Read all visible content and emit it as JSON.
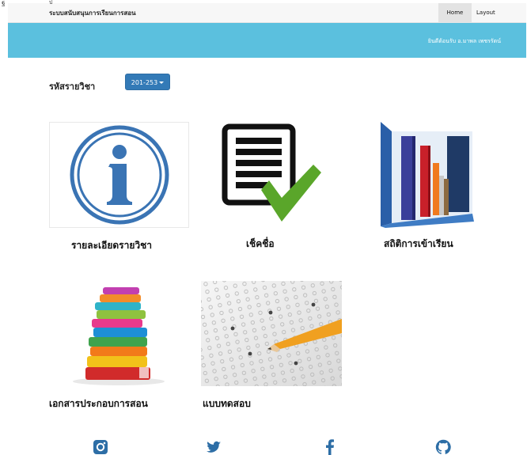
{
  "header": {
    "corner_glyph": "ฐ",
    "corner_mark": "ป",
    "brand": "ระบบสนับสนุนการเรียนการสอน",
    "nav": {
      "home": "Home",
      "layout": "Layout"
    }
  },
  "banner": {
    "welcome": "ยินดีต้อนรับ อ.มาพล เพชรรัตน์"
  },
  "course": {
    "label": "รหัสรายวิชา",
    "selected": "201-253"
  },
  "cards": [
    {
      "title": "รายละเอียดรายวิชา",
      "icon": "info-icon"
    },
    {
      "title": "เช็คชื่อ",
      "icon": "checklist-icon"
    },
    {
      "title": "สถิติการเข้าเรียน",
      "icon": "bar-chart-icon"
    },
    {
      "title": "เอกสารประกอบการสอน",
      "icon": "books-icon"
    },
    {
      "title": "แบบทดสอบ",
      "icon": "exam-sheet-icon"
    }
  ],
  "footer": {
    "icons": [
      "instagram-icon",
      "twitter-icon",
      "facebook-icon",
      "github-icon"
    ]
  },
  "colors": {
    "banner": "#5bc0de",
    "button": "#337ab7",
    "info_blue": "#3a74b4",
    "check_green": "#5aa62a"
  }
}
